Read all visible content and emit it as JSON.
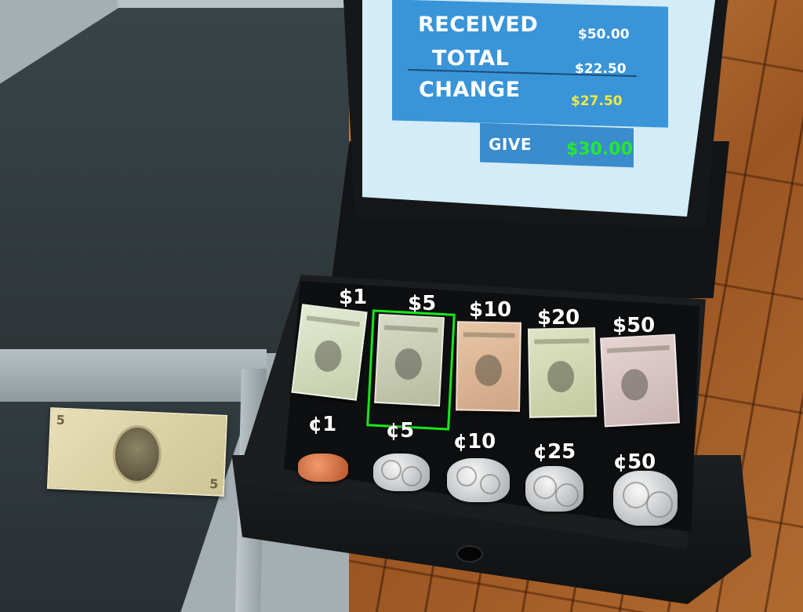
{
  "screen": {
    "received_label": "RECEIVED",
    "received_value": "$50.00",
    "total_label": "TOTAL",
    "total_value": "$22.50",
    "change_label": "CHANGE",
    "change_value": "$27.50",
    "give_label": "GIVE",
    "give_value": "$30.00"
  },
  "drawer": {
    "bills": [
      {
        "label": "$1"
      },
      {
        "label": "$5"
      },
      {
        "label": "$10"
      },
      {
        "label": "$20"
      },
      {
        "label": "$50"
      }
    ],
    "coins": [
      {
        "label": "¢1"
      },
      {
        "label": "¢5"
      },
      {
        "label": "¢10"
      },
      {
        "label": "¢25"
      },
      {
        "label": "¢50"
      }
    ],
    "selected_bill": "$5"
  },
  "colors": {
    "screen_bg": "#d4ecf8",
    "panel_blue": "#3a94d8",
    "change_yellow": "#f2ea3c",
    "give_green": "#22e830",
    "selection_green": "#18e61c"
  },
  "icons": {
    "loose_bill": "five-dollar-bill-icon"
  }
}
